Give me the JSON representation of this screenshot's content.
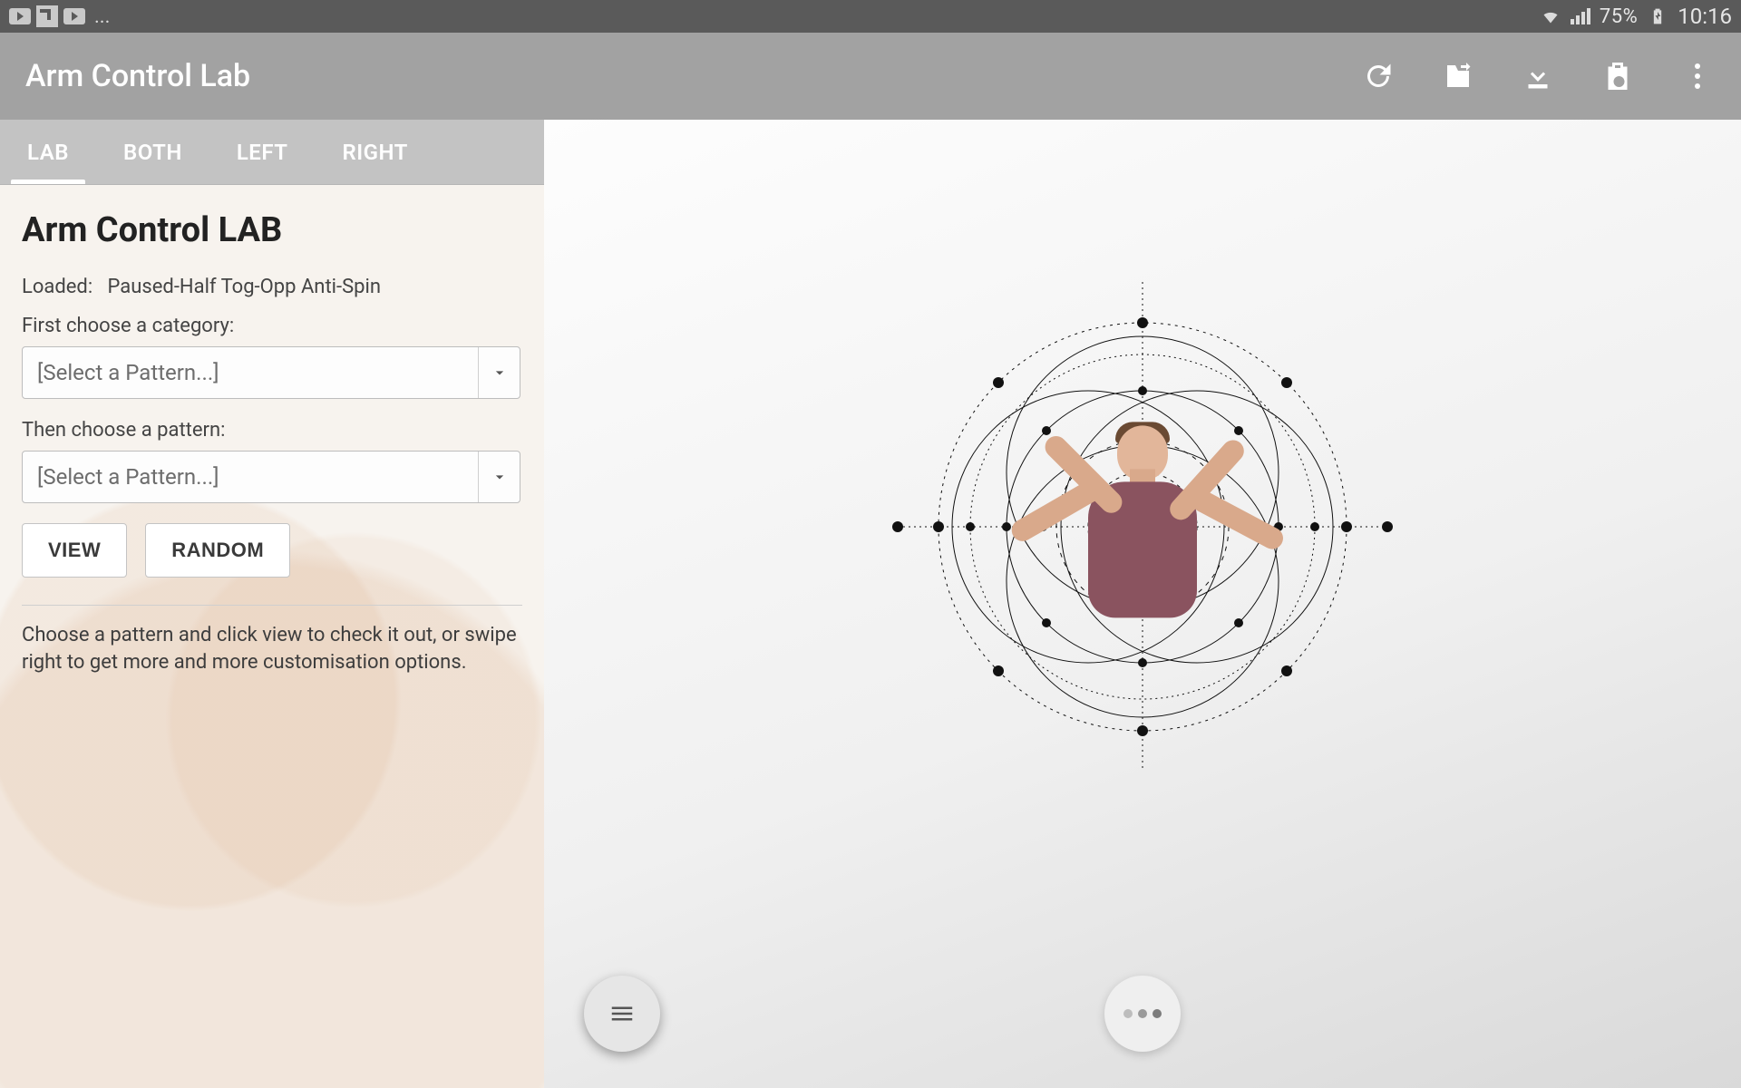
{
  "status_bar": {
    "battery_text": "75%",
    "clock": "10:16",
    "left_notif_overflow": "..."
  },
  "app_bar": {
    "title": "Arm Control Lab"
  },
  "tabs": [
    {
      "id": "lab",
      "label": "LAB",
      "active": true
    },
    {
      "id": "both",
      "label": "BOTH",
      "active": false
    },
    {
      "id": "left",
      "label": "LEFT",
      "active": false
    },
    {
      "id": "right",
      "label": "RIGHT",
      "active": false
    }
  ],
  "panel": {
    "heading": "Arm Control LAB",
    "loaded_label": "Loaded:",
    "loaded_value": "Paused-Half Tog-Opp Anti-Spin",
    "category_label": "First choose a category:",
    "category_placeholder": "[Select a Pattern...]",
    "pattern_label": "Then choose a pattern:",
    "pattern_placeholder": "[Select a Pattern...]",
    "view_btn": "VIEW",
    "random_btn": "RANDOM",
    "help_text": "Choose a pattern and click view to check it out, or swipe right to get more and more customisation options."
  }
}
